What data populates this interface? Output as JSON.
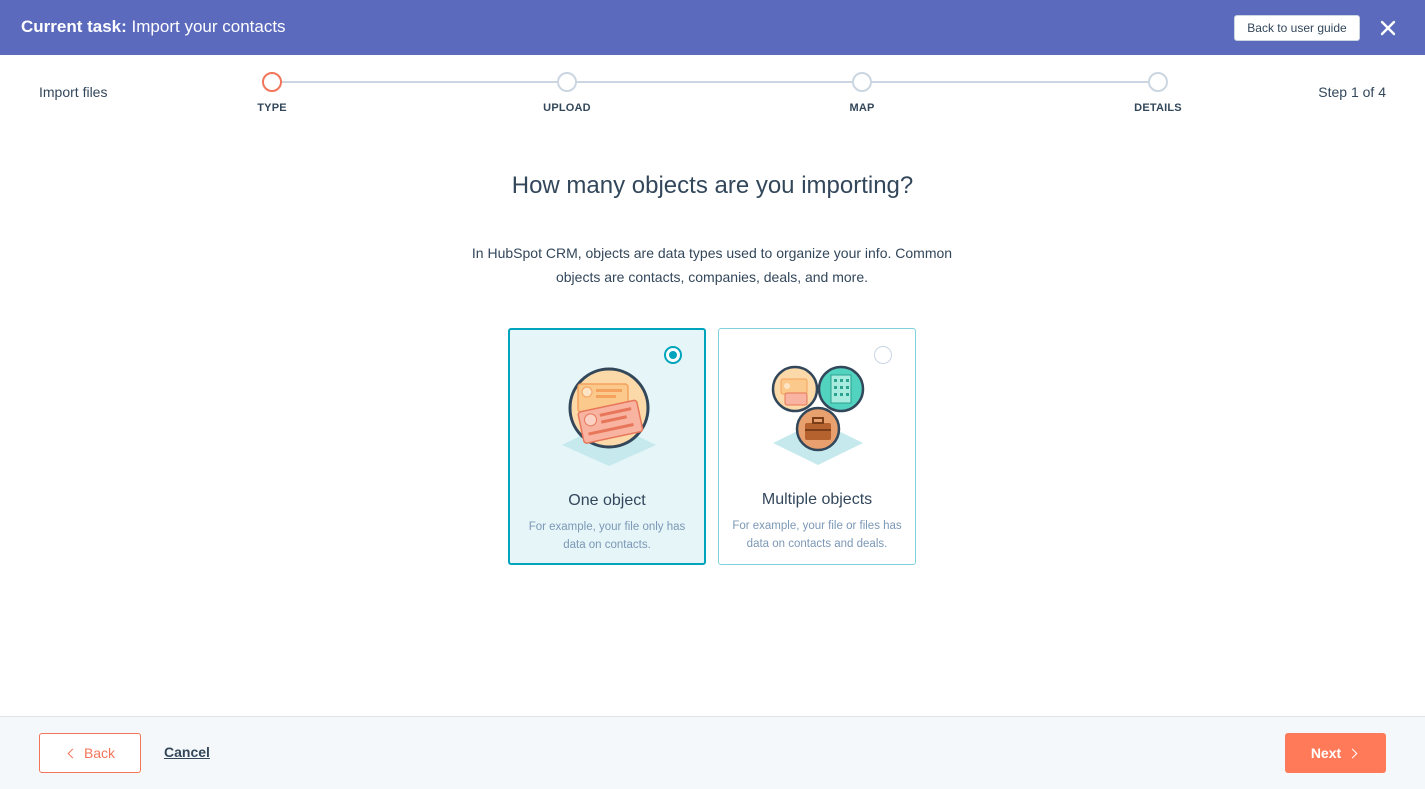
{
  "taskbar": {
    "label": "Current task:",
    "task": "Import your contacts",
    "guide_button": "Back to user guide",
    "close_icon": "close-icon",
    "background": "#5b6abd"
  },
  "stepper": {
    "title": "Import files",
    "step_count": "Step 1 of 4",
    "steps": [
      {
        "label": "TYPE",
        "active": true
      },
      {
        "label": "UPLOAD",
        "active": false
      },
      {
        "label": "MAP",
        "active": false
      },
      {
        "label": "DETAILS",
        "active": false
      }
    ],
    "active_color": "#f2755a"
  },
  "main": {
    "heading": "How many objects are you importing?",
    "description": "In HubSpot CRM, objects are data types used to organize your info. Common objects are contacts, companies, deals, and more."
  },
  "options": [
    {
      "title": "One object",
      "subtitle": "For example, your file only has data on contacts.",
      "selected": true,
      "icon": "contact-card-icon"
    },
    {
      "title": "Multiple objects",
      "subtitle": "For example, your file or files has data on contacts and deals.",
      "selected": false,
      "icon": "multiple-objects-icon"
    }
  ],
  "footer": {
    "back_label": "Back",
    "cancel_label": "Cancel",
    "next_label": "Next",
    "accent": "#ff7a59"
  }
}
